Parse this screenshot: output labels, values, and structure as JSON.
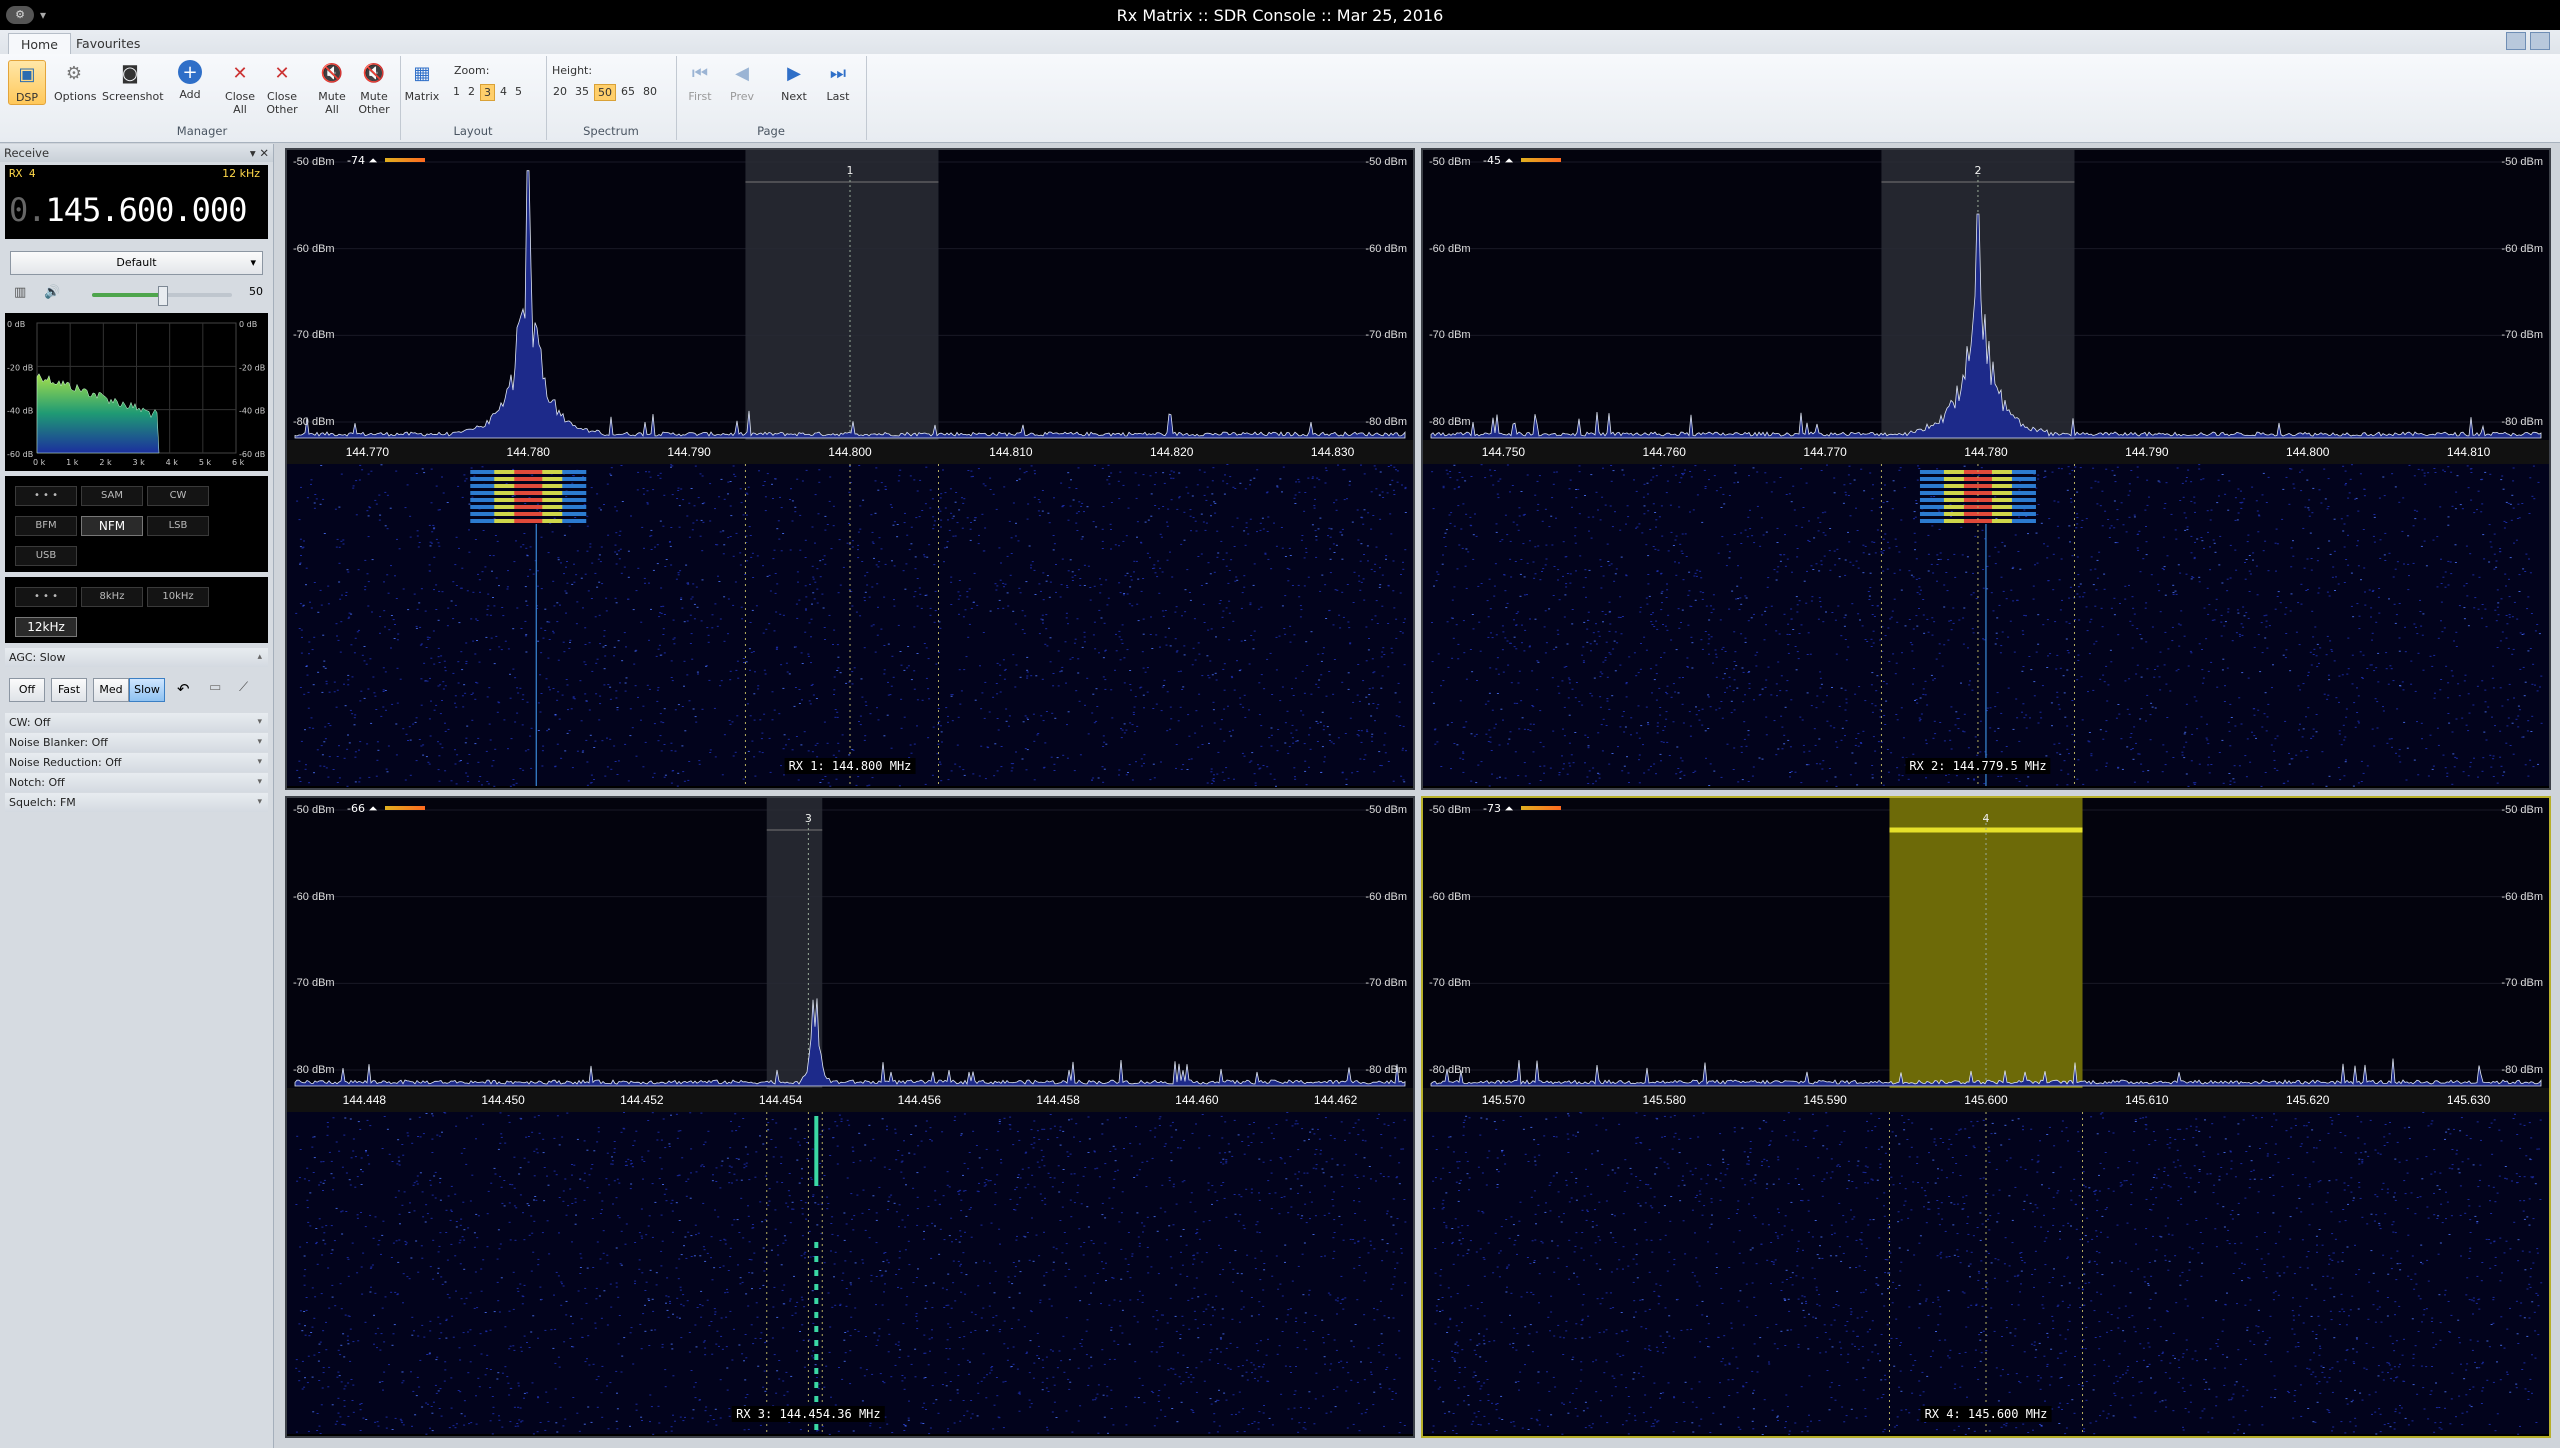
{
  "window": {
    "title": "Rx Matrix :: SDR Console :: Mar 25, 2016"
  },
  "tabs": [
    "Home",
    "Favourites"
  ],
  "ribbon": {
    "manager": {
      "label": "Manager",
      "buttons": [
        "DSP",
        "Options",
        "Screenshot",
        "Add",
        "Close All",
        "Close Other",
        "Mute All",
        "Mute Other"
      ]
    },
    "layout": {
      "label": "Layout",
      "matrix": "Matrix",
      "zoom_label": "Zoom:",
      "zoom_values": [
        "1",
        "2",
        "3",
        "4",
        "5"
      ],
      "zoom_selected": "3"
    },
    "spectrum": {
      "label": "Spectrum",
      "height_label": "Height:",
      "height_values": [
        "20",
        "35",
        "50",
        "65",
        "80"
      ],
      "height_selected": "50"
    },
    "page": {
      "label": "Page",
      "buttons": [
        "First",
        "Prev",
        "Next",
        "Last"
      ]
    }
  },
  "left": {
    "header": "Receive",
    "rx": "RX 4",
    "bandwidth": "12 kHz",
    "freq_dim": "0.",
    "freq": "145.600.000",
    "preset": "Default",
    "volume": 50,
    "volume_text": "50",
    "af_labels": {
      "left": [
        "0 dB",
        "-20 dB",
        "-40 dB",
        "-60 dB"
      ],
      "right": [
        "0 dB",
        "-20 dB",
        "-40 dB",
        "-60 dB"
      ],
      "x": [
        "0 k",
        "1 k",
        "2 k",
        "3 k",
        "4 k",
        "5 k",
        "6 k"
      ]
    },
    "modes": [
      "• • •",
      "SAM",
      "CW",
      "BFM",
      "NFM",
      "LSB",
      "USB"
    ],
    "mode_selected": "NFM",
    "filters": [
      "• • •",
      "8kHz",
      "10kHz",
      "12kHz"
    ],
    "filter_selected": "12kHz",
    "agc_label": "AGC: Slow",
    "agc_buttons": [
      "Off",
      "Fast",
      "Med",
      "Slow"
    ],
    "agc_selected": "Slow",
    "collapsibles": [
      "CW: Off",
      "Noise Blanker: Off",
      "Noise Reduction: Off",
      "Notch: Off",
      "Squelch: FM"
    ]
  },
  "receivers": [
    {
      "num": "1",
      "caption": "RX 1: 144.800 MHz",
      "signal": "-74",
      "ticks": [
        "144.770",
        "144.780",
        "144.790",
        "144.800",
        "144.810",
        "144.820",
        "144.830"
      ],
      "xmin": 144.7655,
      "xmax": 144.8345,
      "filter": [
        144.7935,
        144.8055
      ],
      "center": 144.8,
      "carrier": 144.78,
      "carrier_db": -51,
      "highlight": false,
      "peak_width": 0.0011
    },
    {
      "num": "2",
      "caption": "RX 2: 144.779.5 MHz",
      "signal": "-45",
      "ticks": [
        "144.750",
        "144.760",
        "144.770",
        "144.780",
        "144.790",
        "144.800",
        "144.810"
      ],
      "xmin": 144.7455,
      "xmax": 144.8145,
      "filter": [
        144.7735,
        144.7855
      ],
      "center": 144.7795,
      "carrier": 144.7795,
      "carrier_db": -56,
      "highlight": false,
      "peak_width": 0.0011
    },
    {
      "num": "3",
      "caption": "RX 3: 144.454.36 MHz",
      "signal": "-66",
      "ticks": [
        "144.448",
        "144.450",
        "144.452",
        "144.454",
        "144.456",
        "144.458",
        "144.460",
        "144.462"
      ],
      "xmin": 144.447,
      "xmax": 144.463,
      "filter": [
        144.4538,
        144.4546
      ],
      "center": 144.4544,
      "carrier": 144.4545,
      "carrier_db": -75,
      "highlight": false,
      "peak_width": 5e-05
    },
    {
      "num": "4",
      "caption": "RX 4: 145.600 MHz",
      "signal": "-73",
      "ticks": [
        "145.570",
        "145.580",
        "145.590",
        "145.600",
        "145.610",
        "145.620",
        "145.630"
      ],
      "xmin": 145.5655,
      "xmax": 145.6345,
      "filter": [
        145.594,
        145.606
      ],
      "center": 145.6,
      "carrier": null,
      "carrier_db": null,
      "highlight": true,
      "peak_width": 0
    }
  ],
  "db_labels": [
    "-50 dBm",
    "-60 dBm",
    "-70 dBm",
    "-80 dBm"
  ],
  "colors": {
    "highlight": "#b8b02a",
    "filter_hl": "#6d6a08",
    "spectrum_fill": "#1d2a8a",
    "waterfall_bg": "#02031c"
  }
}
